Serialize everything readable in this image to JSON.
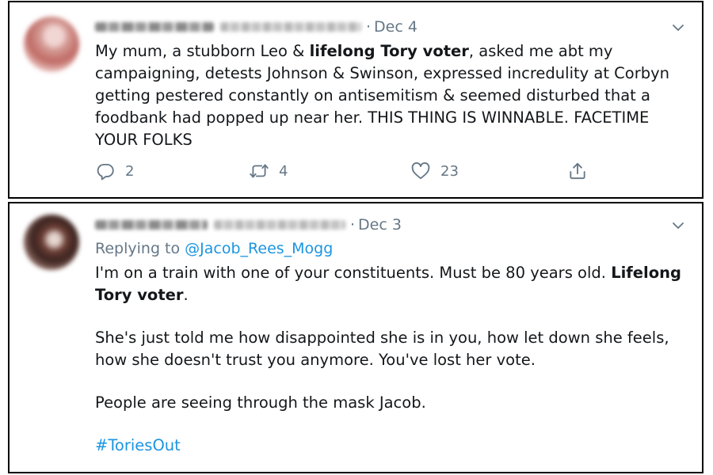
{
  "tweet1": {
    "date": "Dec 4",
    "separator": "·",
    "text_part1": "My mum, a stubborn Leo & ",
    "text_bold": "lifelong Tory voter",
    "text_part2": ", asked me abt my campaigning, detests Johnson & Swinson, expressed incredulity at Corbyn getting pestered constantly on antisemitism & seemed disturbed that a foodbank had popped up near her. THIS THING IS WINNABLE. FACETIME YOUR FOLKS",
    "replies": "2",
    "retweets": "4",
    "likes": "23"
  },
  "tweet2": {
    "date": "Dec 3",
    "separator": "·",
    "replying_prefix": "Replying to ",
    "replying_to": "@Jacob_Rees_Mogg",
    "p1_part1": "I'm on a train with one of your constituents. Must be 80 years old. ",
    "p1_bold": "Lifelong Tory voter",
    "p1_part2": ".",
    "p2": "She's just told me how disappointed she is in you, how let down she feels, how she doesn't trust you anymore. You've lost her vote.",
    "p3": "People are seeing through the mask Jacob.",
    "hashtag": "#ToriesOut"
  },
  "icons": {
    "reply": "reply-icon",
    "retweet": "retweet-icon",
    "like": "heart-icon",
    "share": "share-icon",
    "more": "chevron-down-icon"
  },
  "colors": {
    "link": "#1b95e0",
    "muted": "#657786",
    "text": "#14171a"
  }
}
